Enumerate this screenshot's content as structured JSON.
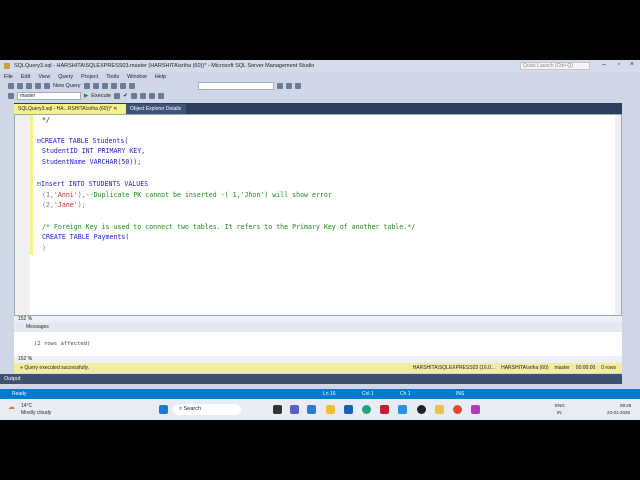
{
  "window": {
    "title": "SQLQuery3.sql - HARSHITA\\SQLEXPRESS03.master (HARSHITA\\sriha (60))* - Microsoft SQL Server Management Studio",
    "quick_launch": "Quick Launch (Ctrl+Q)"
  },
  "menu": [
    "File",
    "Edit",
    "View",
    "Query",
    "Project",
    "Tools",
    "Window",
    "Help"
  ],
  "toolbar": {
    "new_query": "New Query",
    "database": "master",
    "execute": "Execute"
  },
  "tabs": [
    {
      "label": "SQLQuery3.sql - HA...RSHITA\\sriha (60))*"
    },
    {
      "label": "Object Explorer Details"
    }
  ],
  "code": {
    "l1": "*/",
    "l2": "CREATE TABLE Students(",
    "l3": "StudentID INT PRIMARY KEY,",
    "l4": "StudentName VARCHAR(50));",
    "l5": "Insert INTO STUDENTS VALUES",
    "l6a": "(1,",
    "l6b": "'Anni'",
    "l6c": "),",
    "l6d": "--Duplicate PK cannot be inserted -( 1,'Jhon') will show error",
    "l7a": "(2,",
    "l7b": "'Jane'",
    "l7c": ");",
    "l8": "/* Foreign Key is used to connect two tables. It refers to the Primary Key of another table.*/",
    "l9": "CREATE TABLE Payments(",
    "l10": ")"
  },
  "zoom": "152 %",
  "messages": {
    "tab": "Messages",
    "text": "(2 rows affected)"
  },
  "query_status": {
    "text": "Query executed successfully.",
    "server": "HARSHITA\\SQLEXPRESS03 (16.0...",
    "user": "HARSHITA\\sriha (60)",
    "db": "master",
    "time": "00:00:00",
    "rows": "0 rows"
  },
  "output": {
    "title": "Output"
  },
  "statusbar": {
    "ready": "Ready",
    "ln": "Ln 16",
    "col": "Col 1",
    "ch": "Ch 1",
    "mode": "INS"
  },
  "taskbar": {
    "temp": "14°C",
    "weather": "Mostly cloudy",
    "search": "Search",
    "lang1": "ENG",
    "lang2": "IN",
    "time": "09:28",
    "date": "23-01-2026"
  }
}
